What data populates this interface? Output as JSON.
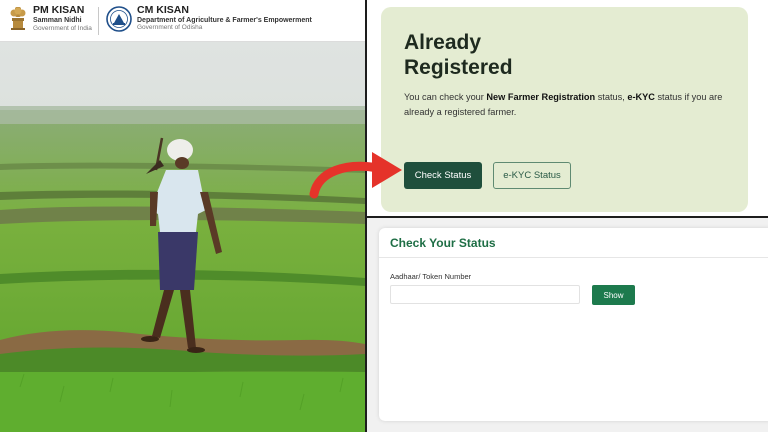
{
  "header": {
    "pm_kisan": {
      "title": "PM KISAN",
      "subtitle": "Samman Nidhi",
      "gov": "Government of India"
    },
    "cm_kisan": {
      "title": "CM KISAN",
      "subtitle": "Department of Agriculture & Farmer's Empowerment",
      "gov": "Government of Odisha"
    }
  },
  "registered_card": {
    "title_line1": "Already",
    "title_line2": "Registered",
    "desc_part1": "You can check your ",
    "desc_bold1": "New Farmer Registration",
    "desc_part2": " status, ",
    "desc_bold2": "e-KYC",
    "desc_part3": " status if you are already a registered farmer.",
    "check_status_label": "Check Status",
    "ekyc_status_label": "e-KYC Status"
  },
  "status_card": {
    "title": "Check Your Status",
    "field_label": "Aadhaar/ Token Number",
    "input_value": "",
    "input_placeholder": "",
    "show_label": "Show"
  },
  "colors": {
    "brand_green": "#1d7a4d",
    "card_bg": "#e4ecd2",
    "arrow_red": "#e5332a"
  }
}
